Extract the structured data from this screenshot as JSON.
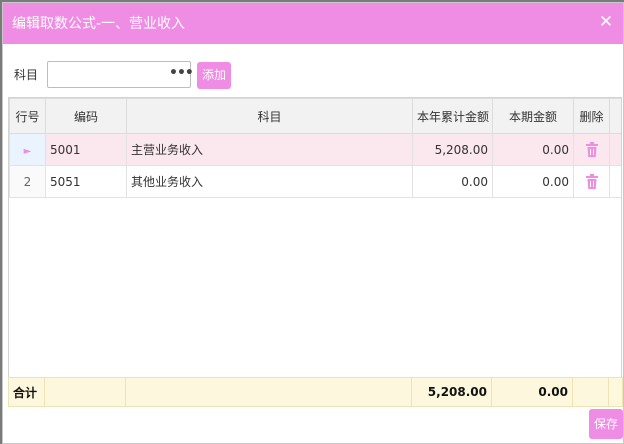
{
  "dialog": {
    "title": "编辑取数公式-一、营业收入",
    "close_glyph": "✕"
  },
  "toolbar": {
    "subject_label": "科目",
    "subject_value": "",
    "more_glyph": "•••",
    "add_label": "添加"
  },
  "table": {
    "columns": [
      "行号",
      "编码",
      "科目",
      "本年累计金额",
      "本期金额",
      "删除"
    ],
    "rows": [
      {
        "row_no": "",
        "selected": true,
        "code": "5001",
        "subject": "主营业务收入",
        "ytd": "5,208.00",
        "period": "0.00"
      },
      {
        "row_no": "2",
        "selected": false,
        "code": "5051",
        "subject": "其他业务收入",
        "ytd": "0.00",
        "period": "0.00"
      }
    ],
    "total": {
      "label": "合计",
      "ytd": "5,208.00",
      "period": "0.00"
    }
  },
  "footer": {
    "save_label": "保存"
  },
  "colors": {
    "accent": "#ef8ce3",
    "selected_row": "#fbe8ef",
    "total_row": "#fdf8dd"
  },
  "icons": {
    "selected_row": "arrow-right-icon",
    "delete": "trash-icon",
    "close": "close-icon",
    "more": "ellipsis-icon"
  }
}
